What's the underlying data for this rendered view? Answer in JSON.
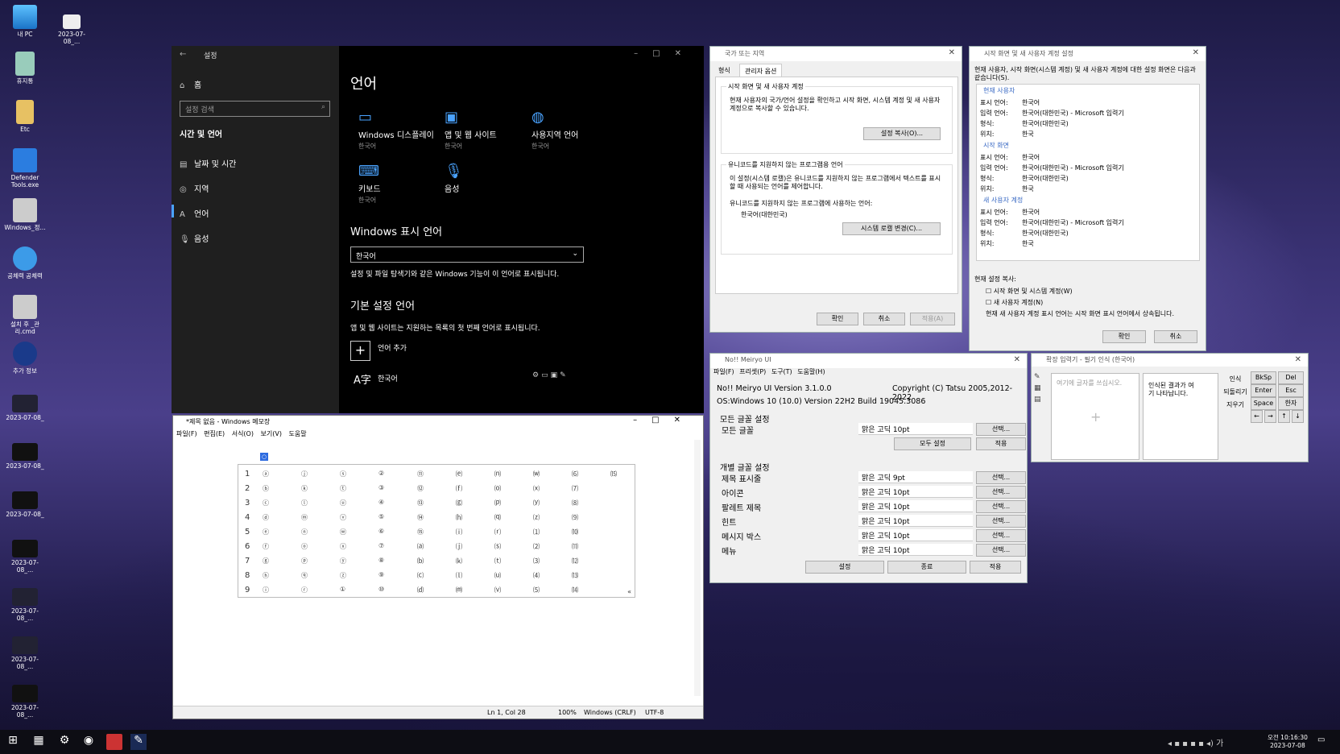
{
  "desktop": {
    "icons": [
      {
        "label": "내 PC"
      },
      {
        "label": "2023-07-08_..."
      },
      {
        "label": "휴지통"
      },
      {
        "label": "Etc"
      },
      {
        "label": "Defender Tools.exe"
      },
      {
        "label": "Windows_정..."
      },
      {
        "label": "공체력 공체력"
      },
      {
        "label": "설치 후 _관리.cmd"
      },
      {
        "label": "추가 정보"
      },
      {
        "label": "2023-07-08_"
      },
      {
        "label": "2023-07-08_"
      },
      {
        "label": "2023-07-08_"
      },
      {
        "label": "2023-07-08_..."
      },
      {
        "label": "2023-07-08_..."
      },
      {
        "label": "2023-07-08_..."
      },
      {
        "label": "2023-07-08_..."
      }
    ]
  },
  "settings": {
    "title": "설정",
    "home": "홈",
    "search_placeholder": "설정 검색",
    "section": "시간 및 언어",
    "nav": [
      "날짜 및 시간",
      "지역",
      "언어",
      "음성"
    ],
    "page_title": "언어",
    "tiles": [
      {
        "label": "Windows 디스플레이",
        "sub": "한국어",
        "icon": "monitor-icon"
      },
      {
        "label": "앱 및 웹 사이트",
        "sub": "한국어",
        "icon": "window-icon"
      },
      {
        "label": "사용지역 언어",
        "sub": "한국어",
        "icon": "globe-icon"
      },
      {
        "label": "키보드",
        "sub": "한국어",
        "icon": "keyboard-icon"
      },
      {
        "label": "음성",
        "sub": "",
        "icon": "microphone-icon"
      }
    ],
    "display_heading": "Windows 표시 언어",
    "display_value": "한국어",
    "display_desc": "설정 및 파일 탐색기와 같은 Windows 기능이 이 언어로 표시됩니다.",
    "pref_heading": "기본 설정 언어",
    "pref_desc": "앱 및 웹 사이트는 지원하는 목록의 첫 번째 언어로 표시됩니다.",
    "add_lang": "언어 추가",
    "lang_item": "한국어"
  },
  "region": {
    "title": "국가 또는 지역",
    "tabs": [
      "형식",
      "관리자 옵션"
    ],
    "welcome_group": "시작 화면 및 새 사용자 계정",
    "welcome_text": "현재 사용자의 국가/언어 설정을 확인하고 시작 화면, 시스템 계정 및 새 사용자 계정으로 복사할 수 있습니다.",
    "copy_btn": "설정 복사(O)...",
    "unicode_group": "유니코드를 지원하지 않는 프로그램용 언어",
    "unicode_text": "이 설정(시스템 로캘)은 유니코드를 지원하지 않는 프로그램에서 텍스트를 표시할 때 사용되는 언어를 제어합니다.",
    "unicode_label": "유니코드를 지원하지 않는 프로그램에 사용하는 언어:",
    "unicode_value": "한국어(대한민국)",
    "change_btn": "시스템 로캘 변경(C)...",
    "ok": "확인",
    "cancel": "취소",
    "apply": "적용(A)"
  },
  "welcome": {
    "title": "시작 화면 및 새 사용자 계정 설정",
    "intro": "현재 사용자, 시작 화면(시스템 계정) 및 새 사용자 계정에 대한 설정 화면은 다음과 같습니다(S).",
    "sections": [
      {
        "name": "현재 사용자",
        "rows": [
          [
            "표시 언어:",
            "한국어"
          ],
          [
            "입력 언어:",
            "한국어(대한민국) - Microsoft 입력기"
          ],
          [
            "형식:",
            "한국어(대한민국)"
          ],
          [
            "위치:",
            "한국"
          ]
        ]
      },
      {
        "name": "시작 화면",
        "rows": [
          [
            "표시 언어:",
            "한국어"
          ],
          [
            "입력 언어:",
            "한국어(대한민국) - Microsoft 입력기"
          ],
          [
            "형식:",
            "한국어(대한민국)"
          ],
          [
            "위치:",
            "한국"
          ]
        ]
      },
      {
        "name": "새 사용자 계정",
        "rows": [
          [
            "표시 언어:",
            "한국어"
          ],
          [
            "입력 언어:",
            "한국어(대한민국) - Microsoft 입력기"
          ],
          [
            "형식:",
            "한국어(대한민국)"
          ],
          [
            "위치:",
            "한국"
          ]
        ]
      }
    ],
    "copy_label": "현재 설정 복사:",
    "cb1": "시작 화면 및 시스템 계정(W)",
    "cb2": "새 사용자 계정(N)",
    "note": "현재 새 사용자 계정 표시 언어는 시작 화면 표시 언어에서 상속됩니다.",
    "ok": "확인",
    "cancel": "취소"
  },
  "meiryo": {
    "title": "No!! Meiryo UI",
    "menu": [
      "파일(F)",
      "프리셋(P)",
      "도구(T)",
      "도움말(H)"
    ],
    "version": "No!! Meiryo UI Version 3.1.0.0",
    "copyright": "Copyright (C) Tatsu 2005,2012-2022",
    "os": "OS:Windows 10 (10.0) Version 22H2 Build 19045.3086",
    "all_group": "모든 글꼴 설정",
    "all_label": "모든 글꼴",
    "all_font": "맑은 고딕  10pt",
    "select": "선택...",
    "set_all": "모두 설정",
    "apply": "적용",
    "indiv_group": "개별 글꼴 설정",
    "rows": [
      {
        "label": "제목 표시줄",
        "font": "맑은 고딕  9pt"
      },
      {
        "label": "아이콘",
        "font": "맑은 고딕  10pt"
      },
      {
        "label": "팔레트 제목",
        "font": "맑은 고딕  10pt"
      },
      {
        "label": "힌트",
        "font": "맑은 고딕  10pt"
      },
      {
        "label": "메시지 박스",
        "font": "맑은 고딕  10pt"
      },
      {
        "label": "메뉴",
        "font": "맑은 고딕  10pt"
      }
    ],
    "settings_btn": "설정",
    "exit_btn": "종료",
    "apply_btn": "적용"
  },
  "handwriting": {
    "title": "확장 입력기 - 필기 인식 (한국어)",
    "pad_hint": "여기에 글자를 쓰십시오.",
    "result_hint": "인식된 결과가 여기 나타납니다.",
    "side": [
      "인식",
      "되돌리기",
      "지우기"
    ],
    "keys": [
      "BkSp",
      "Del",
      "Enter",
      "Esc",
      "Space",
      "한자",
      "←",
      "→",
      "↑",
      "↓"
    ]
  },
  "notepad": {
    "title": "*제목 없음 - Windows 메모장",
    "menu": [
      "파일(F)",
      "편집(E)",
      "서식(O)",
      "보기(V)",
      "도움말"
    ],
    "status": {
      "pos": "Ln 1, Col 28",
      "zoom": "100%",
      "eol": "Windows (CRLF)",
      "enc": "UTF-8"
    },
    "rows": [
      [
        "1",
        "ⓐ",
        "ⓙ",
        "ⓢ",
        "②",
        "⑪",
        "⒠",
        "⒩",
        "⒲",
        "⑹",
        "⒂"
      ],
      [
        "2",
        "ⓑ",
        "ⓚ",
        "ⓣ",
        "③",
        "⑫",
        "⒡",
        "⒪",
        "⒳",
        "⑺",
        ""
      ],
      [
        "3",
        "ⓒ",
        "ⓛ",
        "ⓤ",
        "④",
        "⑬",
        "⒢",
        "⒫",
        "⒴",
        "⑻",
        ""
      ],
      [
        "4",
        "ⓓ",
        "ⓜ",
        "ⓥ",
        "⑤",
        "⑭",
        "⒣",
        "⒬",
        "⒵",
        "⑼",
        ""
      ],
      [
        "5",
        "ⓔ",
        "ⓝ",
        "ⓦ",
        "⑥",
        "⑮",
        "⒤",
        "⒭",
        "⑴",
        "⑽",
        ""
      ],
      [
        "6",
        "ⓕ",
        "ⓞ",
        "ⓧ",
        "⑦",
        "⒜",
        "⒥",
        "⒮",
        "⑵",
        "⑾",
        ""
      ],
      [
        "7",
        "ⓖ",
        "ⓟ",
        "ⓨ",
        "⑧",
        "⒝",
        "⒦",
        "⒯",
        "⑶",
        "⑿",
        ""
      ],
      [
        "8",
        "ⓗ",
        "ⓠ",
        "ⓩ",
        "⑨",
        "⒞",
        "⒧",
        "⒰",
        "⑷",
        "⒀",
        ""
      ],
      [
        "9",
        "ⓘ",
        "ⓡ",
        "①",
        "⑩",
        "⒟",
        "⒨",
        "⒱",
        "⑸",
        "⒁",
        ""
      ]
    ],
    "header": "○",
    "more": "«"
  },
  "taskbar": {
    "time": "오전 10:16:30",
    "date": "2023-07-08",
    "ime": "가"
  },
  "colors": {
    "accent": "#4aa3ff"
  }
}
